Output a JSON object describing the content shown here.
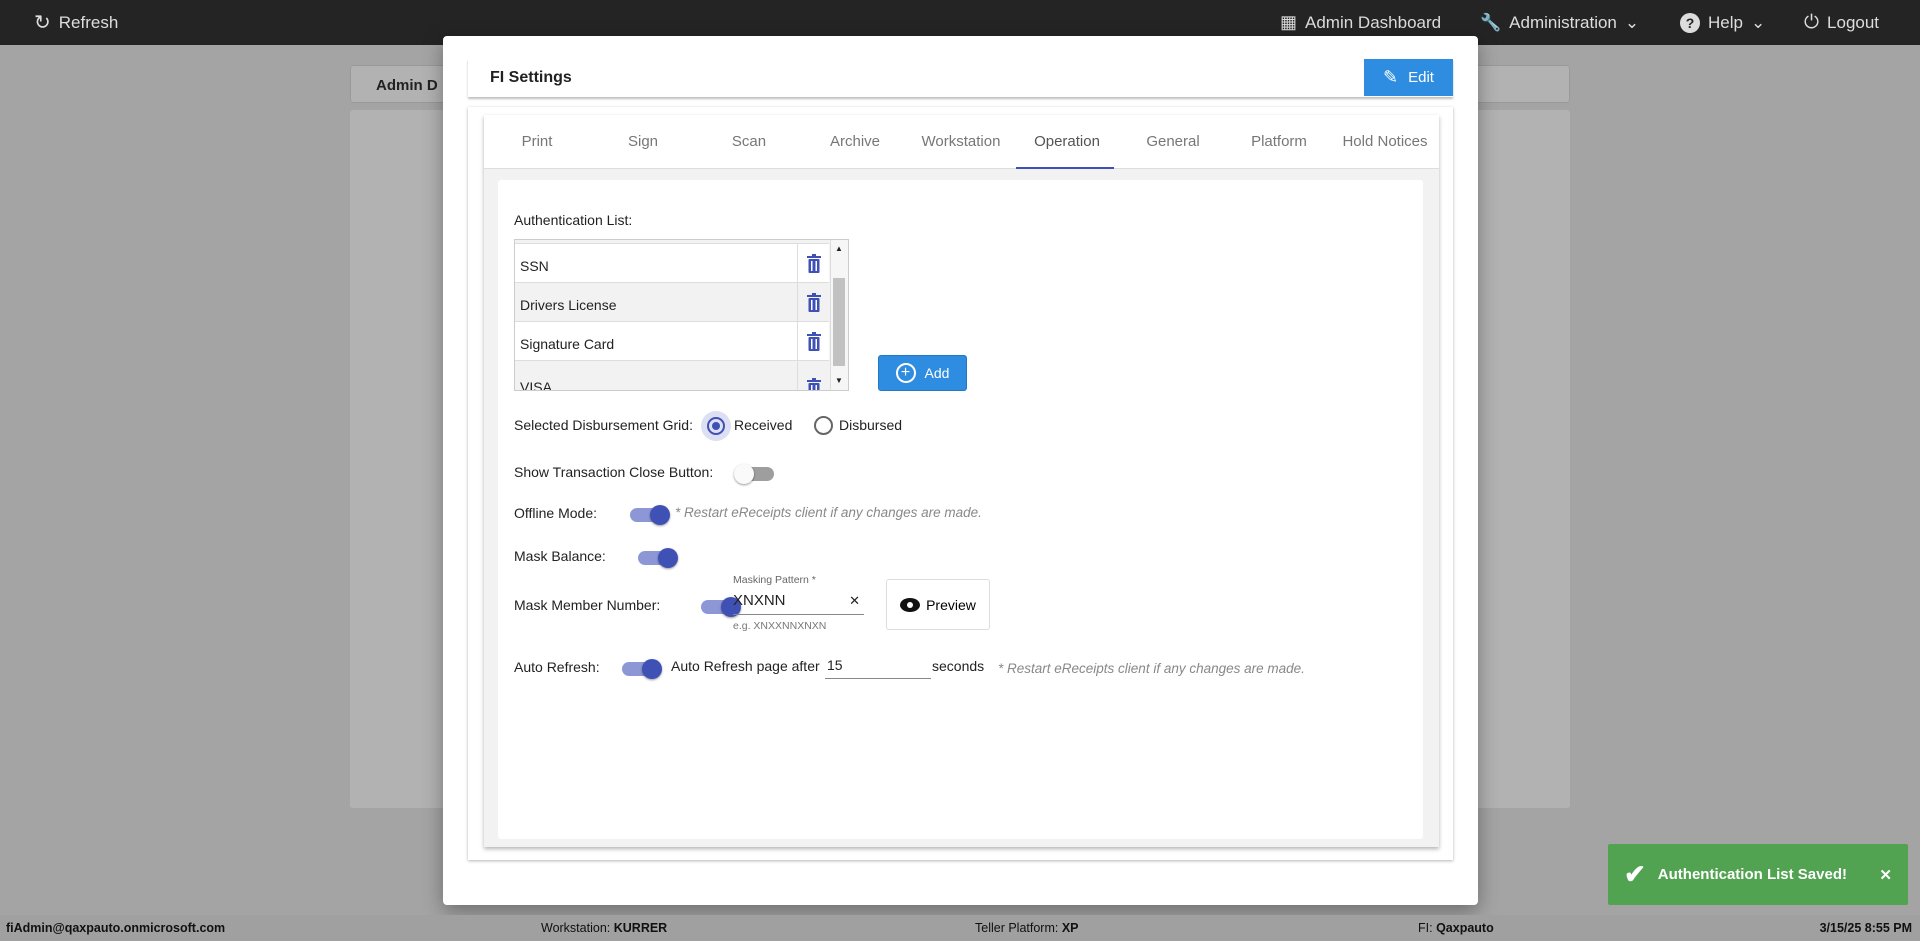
{
  "topbar": {
    "refresh": "Refresh",
    "admin_dashboard": "Admin Dashboard",
    "administration": "Administration",
    "help": "Help",
    "logout": "Logout"
  },
  "background": {
    "panel_title": "Admin D"
  },
  "modal": {
    "title": "FI Settings",
    "edit": "Edit",
    "tabs": [
      "Print",
      "Sign",
      "Scan",
      "Archive",
      "Workstation",
      "Operation",
      "General",
      "Platform",
      "Hold Notices"
    ],
    "active_tab": "Operation",
    "auth_list_label": "Authentication List:",
    "auth_items": [
      "SSN",
      "Drivers License",
      "Signature Card",
      "VISA"
    ],
    "add": "Add",
    "disb_label": "Selected Disbursement Grid:",
    "disb_options": [
      "Received",
      "Disbursed"
    ],
    "disb_selected": "Received",
    "show_close_label": "Show Transaction Close Button:",
    "show_close_on": false,
    "offline_label": "Offline Mode:",
    "offline_on": true,
    "restart_note": "* Restart eReceipts client if any changes are made.",
    "mask_balance_label": "Mask Balance:",
    "mask_balance_on": true,
    "mask_member_label": "Mask Member Number:",
    "mask_member_on": true,
    "masking_pattern_label": "Masking Pattern *",
    "masking_pattern_value": "XNXNN",
    "masking_pattern_hint": "e.g. XNXXNNXNXN",
    "clear": "✕",
    "preview": "Preview",
    "auto_refresh_label": "Auto Refresh:",
    "auto_refresh_on": true,
    "auto_refresh_text": "Auto Refresh page after",
    "auto_refresh_value": "15",
    "seconds": "seconds"
  },
  "toast": {
    "message": "Authentication List Saved!",
    "close": "✕",
    "color": "#51a351"
  },
  "footer": {
    "user": "fiAdmin@qaxpauto.onmicrosoft.com",
    "workstation_label": "Workstation:",
    "workstation": "KURRER",
    "platform_label": "Teller Platform:",
    "platform": "XP",
    "fi_label": "FI:",
    "fi": "Qaxpauto",
    "datetime": "3/15/25 8:55 PM"
  }
}
